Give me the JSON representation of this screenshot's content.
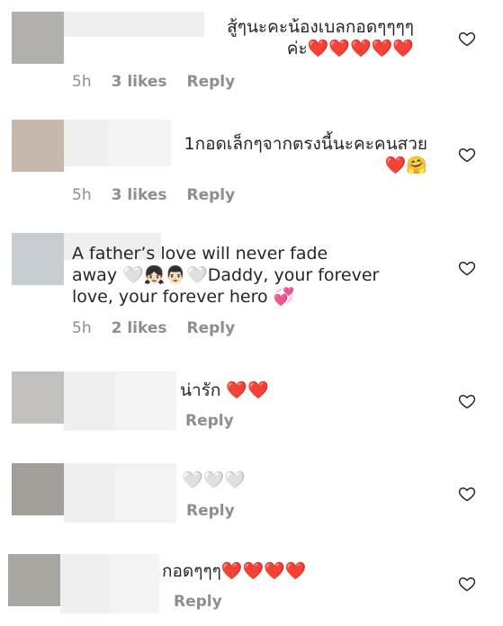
{
  "comments": [
    {
      "avatar_color": "#b2b0ac",
      "text": "สู้ๆนะคะน้องเบลกอดๆๆๆๆ\nค่ะ❤️❤️❤️❤️❤️",
      "time": "5h",
      "likes": "3 likes",
      "reply": "Reply"
    },
    {
      "avatar_color": "#c5b9ae",
      "text": "1กอดเล็กๆจากตรงนี้นะคะคนสวย\n❤️🤗",
      "time": "5h",
      "likes": "3 likes",
      "reply": "Reply"
    },
    {
      "avatar_color": "#c8cdd2",
      "text": "A father’s love will never fade\naway 🤍👧🏻👨🏻🤍Daddy, your forever\nlove, your forever hero 💞",
      "time": "5h",
      "likes": "2 likes",
      "reply": "Reply"
    },
    {
      "avatar_color": "#c2c1bd",
      "text": "น่ารัก ❤️❤️",
      "reply": "Reply"
    },
    {
      "avatar_color": "#a29e99",
      "text": "🤍🤍🤍",
      "reply": "Reply"
    },
    {
      "avatar_color": "#a9a6a1",
      "text": "กอดๆๆๆ❤️❤️❤️❤️",
      "reply": "Reply"
    }
  ],
  "icons": {
    "like": "heart-outline-icon"
  }
}
